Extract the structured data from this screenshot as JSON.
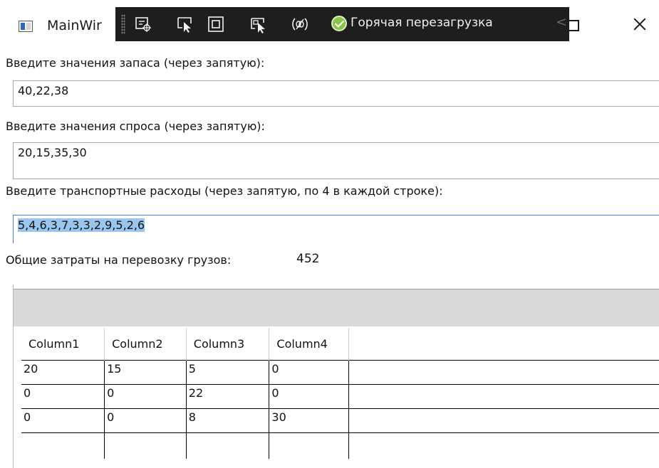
{
  "window": {
    "title": "MainWir",
    "icon": "window-app-icon"
  },
  "toolbar": {
    "icons": [
      "element-selection-icon",
      "select-cursor-icon",
      "layout-adorner-icon",
      "track-focus-icon",
      "binding-failures-icon",
      "hot-reload-check-icon",
      "collapse-toolbar-icon"
    ],
    "hot_reload_label": "Горячая перезагрузка",
    "collapse_glyph": "<"
  },
  "form": {
    "supply_label": "Введите значения запаса (через запятую):",
    "supply_value": "40,22,38",
    "demand_label": "Введите значения спроса (через запятую):",
    "demand_value": "20,15,35,30",
    "costs_label": "Введите транспортные расходы (через запятую, по 4 в каждой строке):",
    "costs_value": "5,4,6,3,7,3,3,2,9,5,2,6",
    "total_label": "Общие затраты на перевозку грузов:",
    "total_value": "452"
  },
  "grid": {
    "columns": [
      "Column1",
      "Column2",
      "Column3",
      "Column4"
    ],
    "rows": [
      [
        "20",
        "15",
        "5",
        "0"
      ],
      [
        "0",
        "0",
        "22",
        "0"
      ],
      [
        "0",
        "0",
        "8",
        "30"
      ]
    ]
  },
  "colors": {
    "selection": "#99c5ee",
    "focus_border": "#3d7fd3",
    "toolbar_bg": "#1e1e1e",
    "hot_reload_ok": "#8bc34a",
    "grid_header_bar": "#d9d9d9"
  }
}
